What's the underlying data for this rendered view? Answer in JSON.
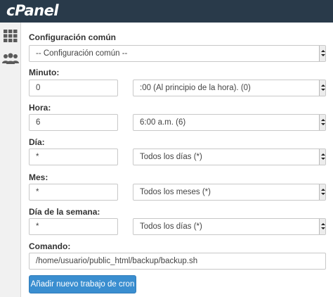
{
  "header": {
    "logo_text": "cPanel"
  },
  "sidebar": {
    "items": [
      {
        "icon": "grid-icon"
      },
      {
        "icon": "users-icon"
      }
    ]
  },
  "form": {
    "common": {
      "label": "Configuración común",
      "value": "-- Configuración común --"
    },
    "minute": {
      "label": "Minuto:",
      "value": "0",
      "select_value": ":00 (Al principio de la hora). (0)"
    },
    "hour": {
      "label": "Hora:",
      "value": "6",
      "select_value": "6:00 a.m. (6)"
    },
    "day": {
      "label": "Día:",
      "value": "*",
      "select_value": "Todos los días (*)"
    },
    "month": {
      "label": "Mes:",
      "value": "*",
      "select_value": "Todos los meses (*)"
    },
    "weekday": {
      "label": "Día de la semana:",
      "value": "*",
      "select_value": "Todos los días (*)"
    },
    "command": {
      "label": "Comando:",
      "value": "/home/usuario/public_html/backup/backup.sh"
    },
    "submit_label": "Añadir nuevo trabajo de cron"
  }
}
